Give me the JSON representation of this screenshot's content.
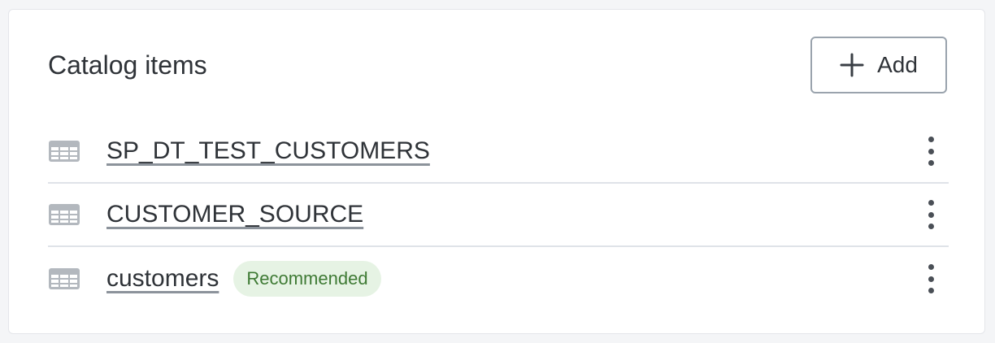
{
  "card": {
    "title": "Catalog items",
    "add_button": {
      "label": "Add",
      "icon": "plus-icon"
    }
  },
  "items": [
    {
      "name": "SP_DT_TEST_CUSTOMERS",
      "badge": "",
      "icon": "table-icon"
    },
    {
      "name": "CUSTOMER_SOURCE",
      "badge": "",
      "icon": "table-icon"
    },
    {
      "name": "customers",
      "badge": "Recommended",
      "icon": "table-icon"
    }
  ],
  "colors": {
    "badge_bg": "#e6f3e4",
    "badge_text": "#3e7a34",
    "icon_gray": "#b3b8be"
  }
}
